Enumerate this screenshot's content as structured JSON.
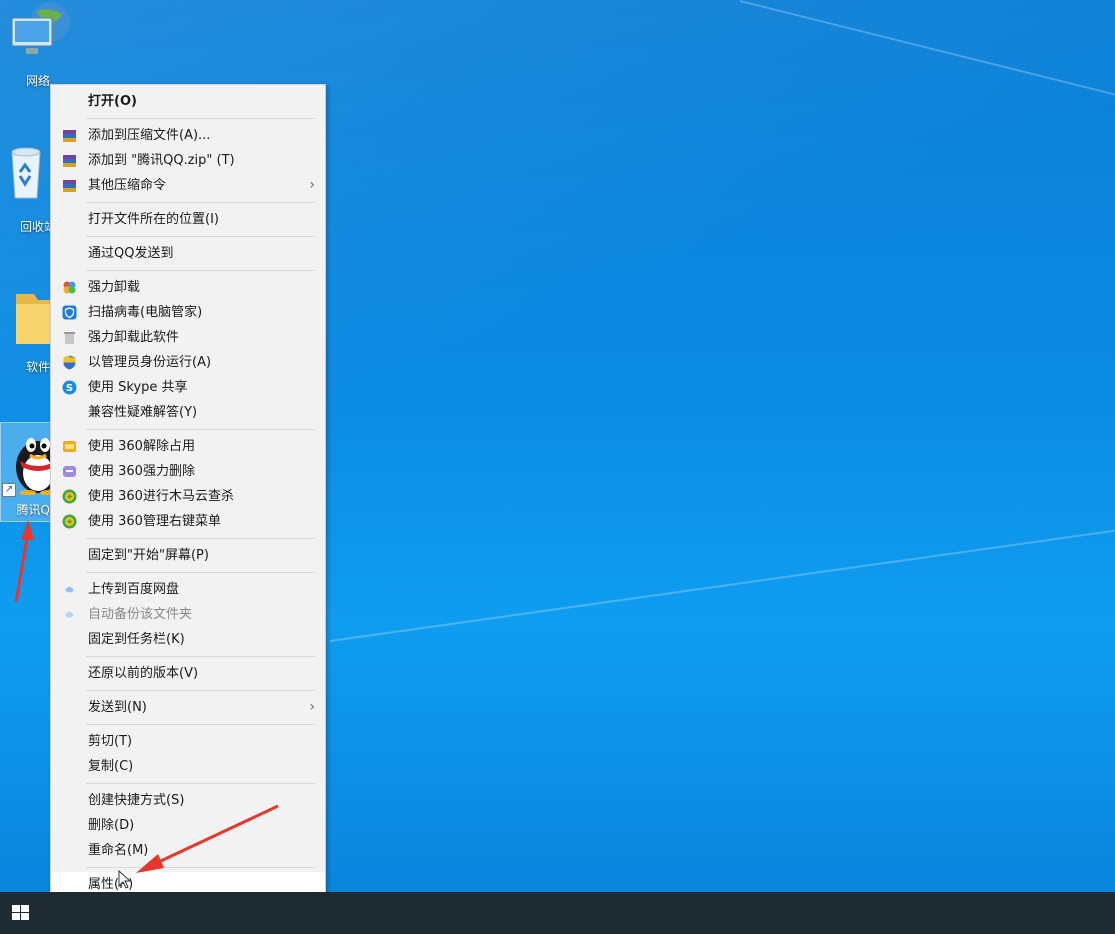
{
  "desktop": {
    "icons": [
      {
        "label": "网络",
        "icon": "network-icon"
      },
      {
        "label": "回收站",
        "icon": "recycle-bin-icon"
      },
      {
        "label": "软件",
        "icon": "folder-icon"
      },
      {
        "label": "腾讯QQ",
        "icon": "qq-penguin-icon"
      }
    ]
  },
  "menu": {
    "items": [
      {
        "label": "打开(O)",
        "icon": null
      },
      {
        "label": "添加到压缩文件(A)...",
        "icon": "winrar-icon"
      },
      {
        "label": "添加到 \"腾讯QQ.zip\" (T)",
        "icon": "winrar-icon"
      },
      {
        "label": "其他压缩命令",
        "icon": "winrar-icon",
        "submenu": true
      },
      {
        "label": "打开文件所在的位置(I)",
        "icon": null
      },
      {
        "label": "通过QQ发送到",
        "icon": null
      },
      {
        "label": "强力卸载",
        "icon": "clover-icon"
      },
      {
        "label": "扫描病毒(电脑管家)",
        "icon": "shield-icon"
      },
      {
        "label": "强力卸载此软件",
        "icon": "trash-icon"
      },
      {
        "label": "以管理员身份运行(A)",
        "icon": "uac-shield-icon"
      },
      {
        "label": "使用 Skype 共享",
        "icon": "skype-icon"
      },
      {
        "label": "兼容性疑难解答(Y)",
        "icon": null
      },
      {
        "label": "使用 360解除占用",
        "icon": "360-unlock-icon"
      },
      {
        "label": "使用 360强力删除",
        "icon": "360-delete-icon"
      },
      {
        "label": "使用 360进行木马云查杀",
        "icon": "360-scan-icon"
      },
      {
        "label": "使用 360管理右键菜单",
        "icon": "360-menu-icon"
      },
      {
        "label": "固定到\"开始\"屏幕(P)",
        "icon": null
      },
      {
        "label": "上传到百度网盘",
        "icon": "baidu-cloud-icon"
      },
      {
        "label": "自动备份该文件夹",
        "icon": "baidu-cloud-icon",
        "dim": true
      },
      {
        "label": "固定到任务栏(K)",
        "icon": null
      },
      {
        "label": "还原以前的版本(V)",
        "icon": null
      },
      {
        "label": "发送到(N)",
        "icon": null,
        "submenu": true
      },
      {
        "label": "剪切(T)",
        "icon": null
      },
      {
        "label": "复制(C)",
        "icon": null
      },
      {
        "label": "创建快捷方式(S)",
        "icon": null
      },
      {
        "label": "删除(D)",
        "icon": null
      },
      {
        "label": "重命名(M)",
        "icon": null
      },
      {
        "label": "属性(R)",
        "icon": null
      }
    ],
    "submenu_arrow": "›"
  },
  "taskbar": {
    "start_icon": "windows-start-icon"
  },
  "annotation_color": "#e8362b"
}
